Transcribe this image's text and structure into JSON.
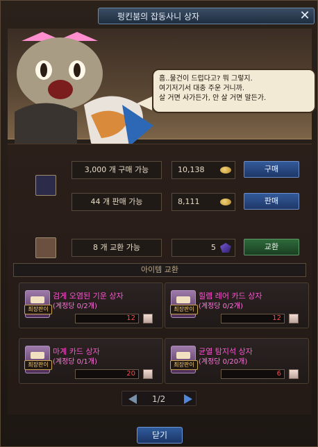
{
  "window": {
    "title": "펑킨붐의 잡동사니 상자"
  },
  "npc": {
    "speech_lines": [
      "흠..물건이 드럽다고? 뭐 그렇지.",
      "여기저기서 대충 주운 거니까.",
      "살 거면 사가든가, 안 살 거면 말든가."
    ]
  },
  "trade": {
    "row1": {
      "buy_stock_text": "3,000 개 구매 가능",
      "buy_price": "10,138",
      "buy_button": "구매",
      "sell_stock_text": "44 개 판매 가능",
      "sell_price": "8,111",
      "sell_button": "판매"
    },
    "row2": {
      "exchange_stock_text": "8 개 교환 가능",
      "exchange_cost": "5",
      "exchange_button": "교환"
    }
  },
  "item_exchange": {
    "section_label": "아이템 교환",
    "cards": [
      {
        "title": "검게 오염된 기운 상자",
        "limit": "(계정당 0/2개)",
        "price": "12",
        "badge": "최장판이"
      },
      {
        "title": "힐렘 레어 카드 상자",
        "limit": "(계정당 0/2개)",
        "price": "12",
        "badge": "최장판이"
      },
      {
        "title": "마계 카드 상자",
        "limit": "(계정당 0/1개)",
        "price": "20",
        "badge": "최장판이"
      },
      {
        "title": "균열 탐지석 상자",
        "limit": "(계정당 0/20개)",
        "price": "6",
        "badge": "최장판이"
      }
    ]
  },
  "pagination": {
    "page_text": "1/2"
  },
  "footer": {
    "close_button": "닫기"
  },
  "colors": {
    "title_bar": "#2a4a6a",
    "button_blue": "#2b4f8e",
    "button_green": "#2e6a3a",
    "item_title": "#ff53d3",
    "price_red": "#ff4a4a"
  }
}
